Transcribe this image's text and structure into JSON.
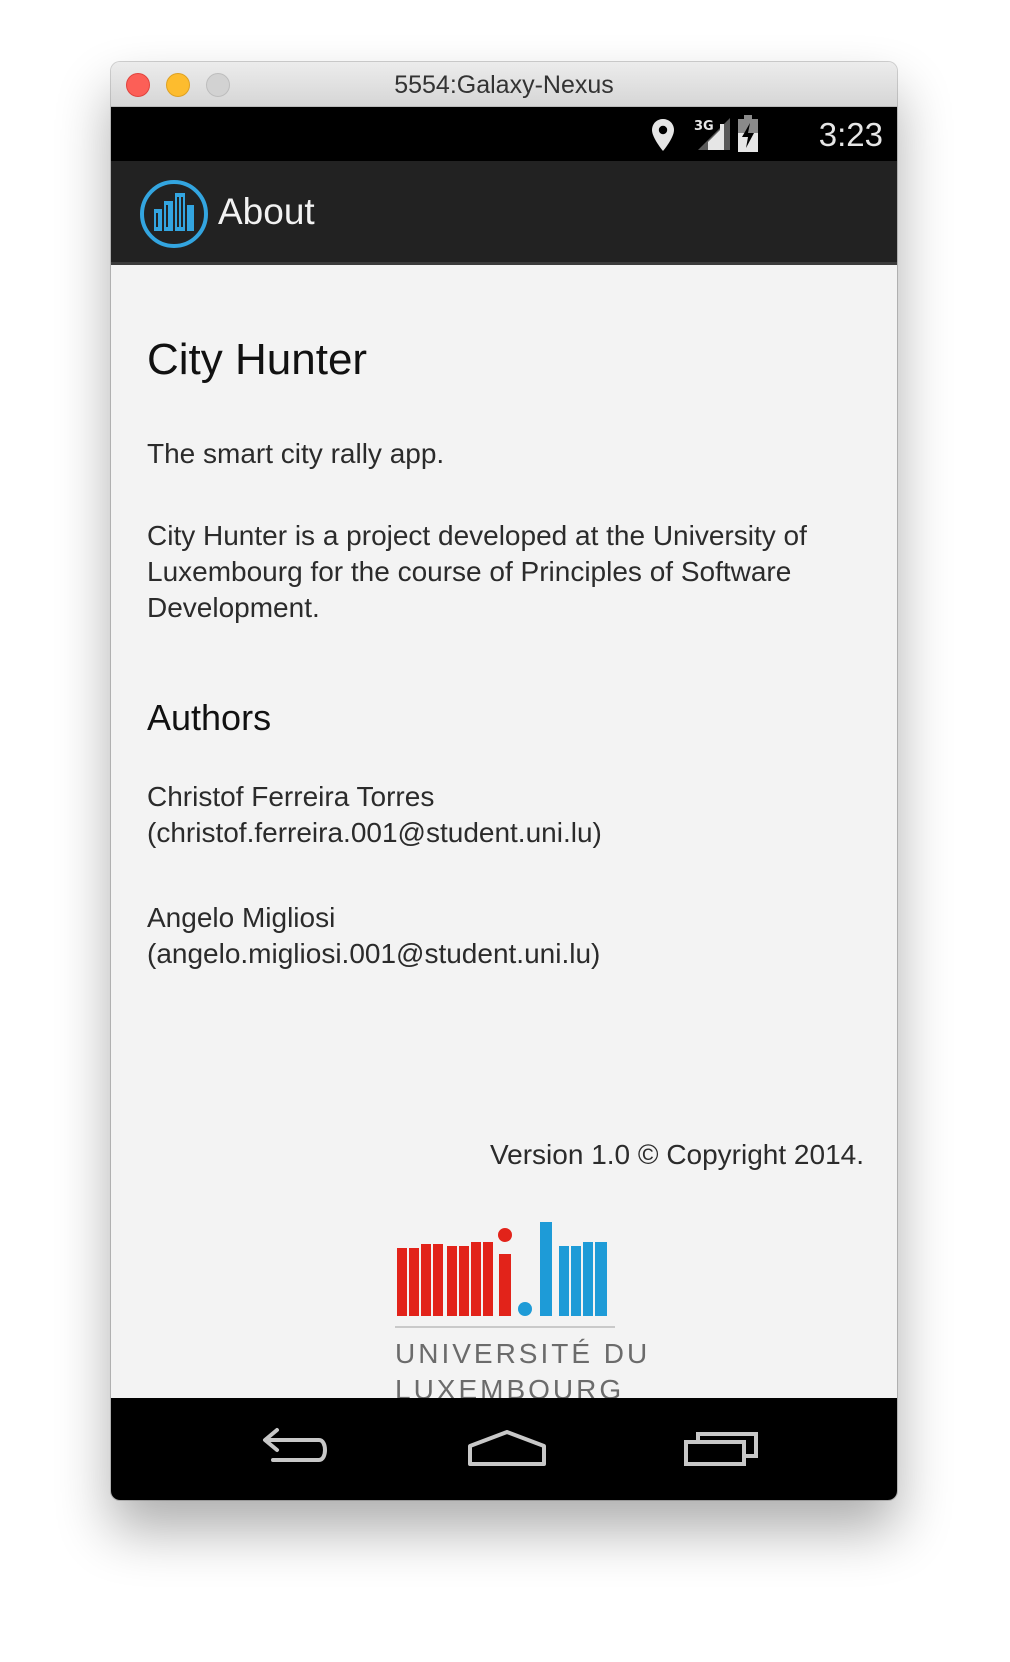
{
  "window": {
    "title": "5554:Galaxy-Nexus"
  },
  "status_bar": {
    "time": "3:23",
    "network": "3G",
    "icons": [
      "location-pin-icon",
      "signal-3g-icon",
      "battery-charging-icon"
    ]
  },
  "action_bar": {
    "title": "About",
    "icon": "city-hunter-app-icon",
    "icon_color": "#33a5e0"
  },
  "content": {
    "app_name": "City Hunter",
    "tagline": "The smart city rally app.",
    "description": "City Hunter is a project developed at the University of Luxembourg for the course of Principles of Software Development.",
    "authors_heading": "Authors",
    "authors": [
      {
        "name": "Christof Ferreira Torres",
        "email": "(christof.ferreira.001@student.uni.lu)"
      },
      {
        "name": "Angelo Migliosi",
        "email": "(angelo.migliosi.001@student.uni.lu)"
      }
    ],
    "version": "Version 1.0 © Copyright 2014."
  },
  "logo": {
    "mark_left": "uni",
    "mark_right": "lu",
    "line1": "UNIVERSITÉ DU",
    "line2": "LUXEMBOURG",
    "red": "#e2231a",
    "blue": "#1e9bd7"
  },
  "nav_bar": {
    "buttons": [
      "back-icon",
      "home-icon",
      "recent-apps-icon"
    ]
  }
}
